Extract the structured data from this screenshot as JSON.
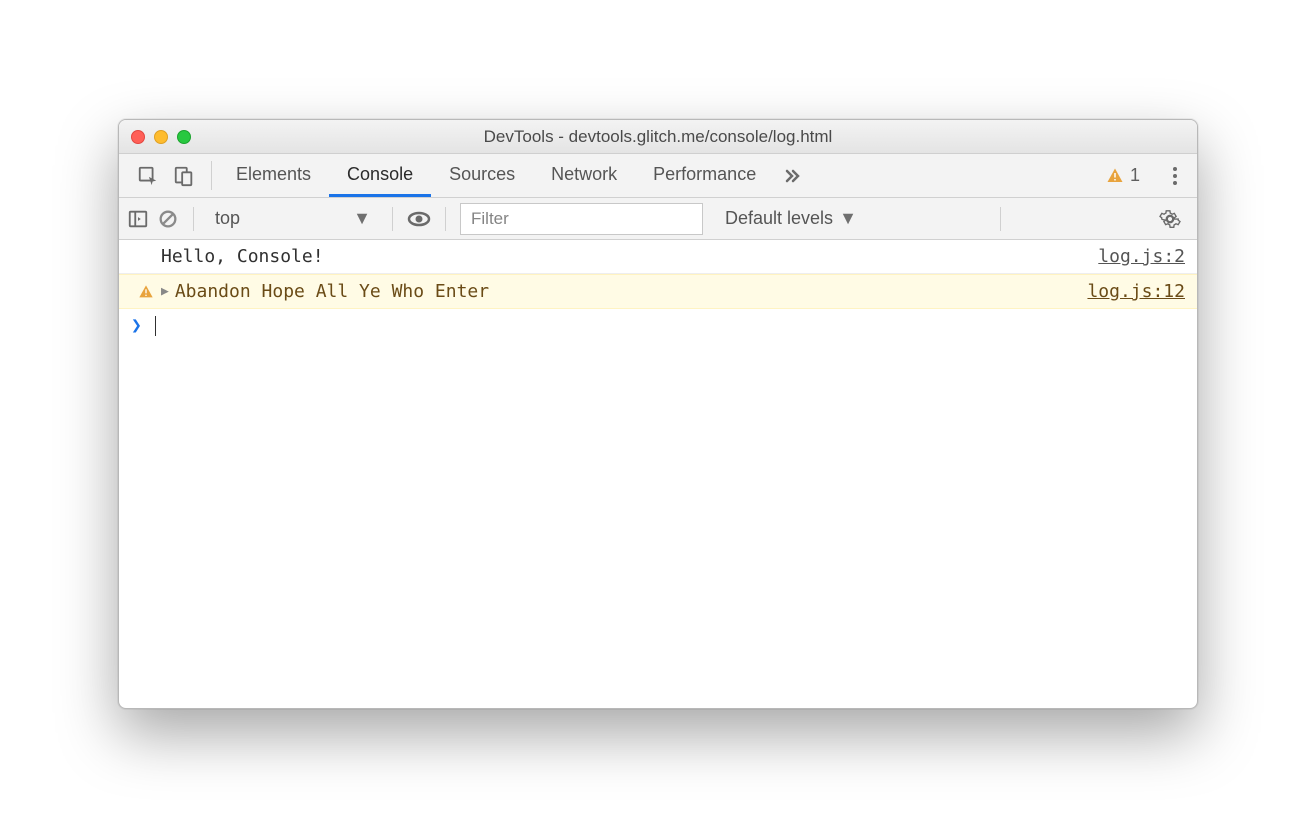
{
  "window": {
    "title": "DevTools - devtools.glitch.me/console/log.html"
  },
  "tabs": {
    "elements": "Elements",
    "console": "Console",
    "sources": "Sources",
    "network": "Network",
    "performance": "Performance"
  },
  "badge": {
    "warning_count": "1"
  },
  "toolbar": {
    "context": "top",
    "filter_placeholder": "Filter",
    "levels": "Default levels"
  },
  "log": [
    {
      "type": "log",
      "text": "Hello, Console!",
      "src": "log.js:2"
    },
    {
      "type": "warn",
      "text": "Abandon Hope All Ye Who Enter",
      "src": "log.js:12"
    }
  ]
}
